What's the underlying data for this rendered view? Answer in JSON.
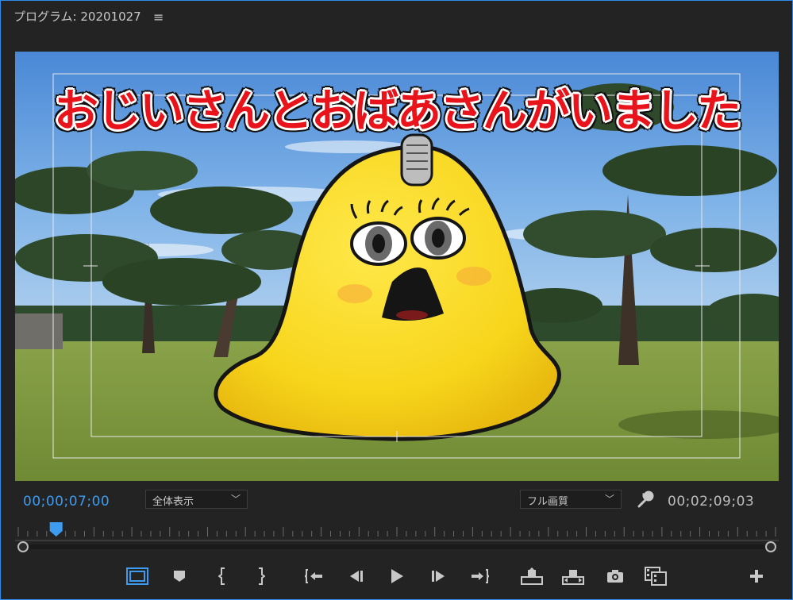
{
  "panel": {
    "title": "プログラム: 20201027",
    "menu_icon": "hamburger-menu-icon"
  },
  "viewer": {
    "caption": "おじいさんとおばあさんがいました"
  },
  "status": {
    "current_timecode": "00;00;07;00",
    "zoom_value": "全体表示",
    "quality_value": "フル画質",
    "duration_timecode": "00;02;09;03",
    "accent_color": "#3d9bf0"
  },
  "timeline": {
    "playhead_position": 0.05
  },
  "controls": [
    {
      "name": "safe-margins-button",
      "icon": "safe-margins-icon"
    },
    {
      "name": "add-marker-button",
      "icon": "marker-icon"
    },
    {
      "name": "mark-in-button",
      "icon": "mark-in-icon"
    },
    {
      "name": "mark-out-button",
      "icon": "mark-out-icon"
    },
    {
      "name": "go-to-in-button",
      "icon": "go-to-in-icon"
    },
    {
      "name": "step-back-button",
      "icon": "step-back-icon"
    },
    {
      "name": "play-button",
      "icon": "play-icon"
    },
    {
      "name": "step-forward-button",
      "icon": "step-forward-icon"
    },
    {
      "name": "go-to-out-button",
      "icon": "go-to-out-icon"
    },
    {
      "name": "lift-button",
      "icon": "lift-icon"
    },
    {
      "name": "extract-button",
      "icon": "extract-icon"
    },
    {
      "name": "export-frame-button",
      "icon": "camera-icon"
    },
    {
      "name": "comparison-view-button",
      "icon": "comparison-view-icon"
    },
    {
      "name": "add-button",
      "icon": "plus-icon"
    }
  ]
}
